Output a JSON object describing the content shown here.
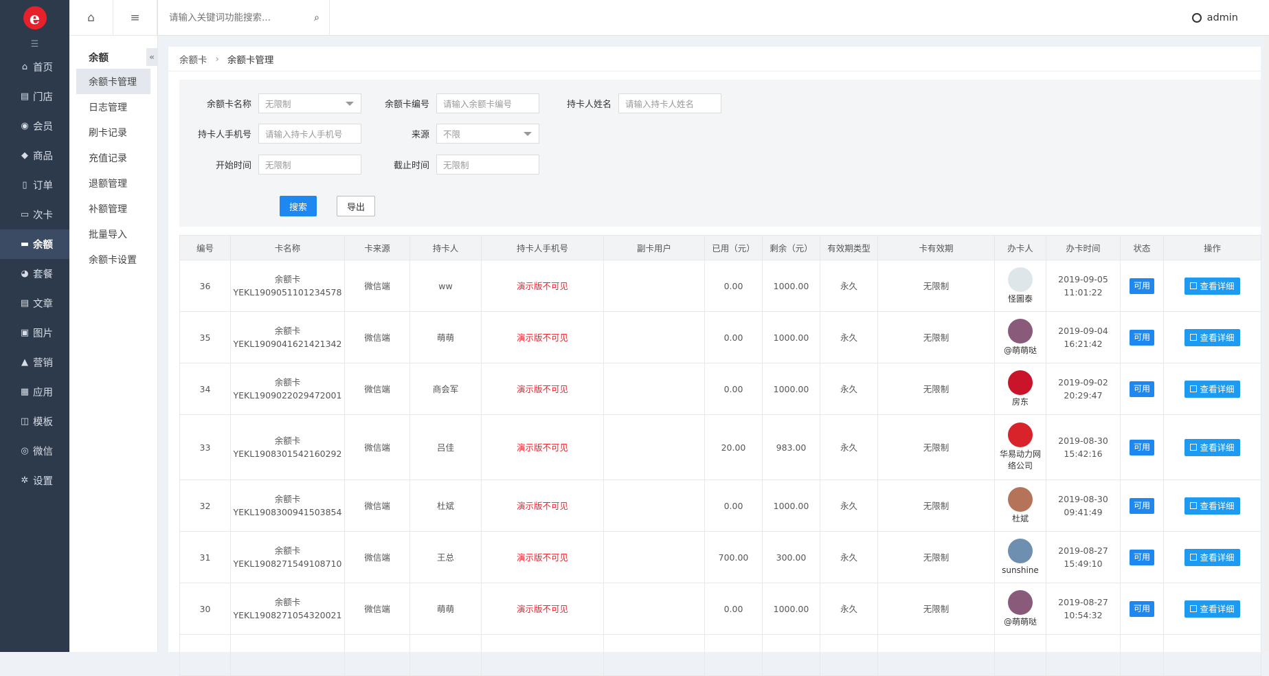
{
  "logo": {
    "letter": "e"
  },
  "nav": {
    "items": [
      {
        "label": "首页",
        "icon": "home-icon",
        "glyph": "⌂"
      },
      {
        "label": "门店",
        "icon": "store-icon",
        "glyph": "▤"
      },
      {
        "label": "会员",
        "icon": "member-icon",
        "glyph": "◉"
      },
      {
        "label": "商品",
        "icon": "tag-icon",
        "glyph": "◆"
      },
      {
        "label": "订单",
        "icon": "order-icon",
        "glyph": "▯"
      },
      {
        "label": "次卡",
        "icon": "card-icon",
        "glyph": "▭"
      },
      {
        "label": "余额",
        "icon": "balance-icon",
        "glyph": "▬",
        "active": true
      },
      {
        "label": "套餐",
        "icon": "dashboard-icon",
        "glyph": "◕"
      },
      {
        "label": "文章",
        "icon": "article-icon",
        "glyph": "▤"
      },
      {
        "label": "图片",
        "icon": "image-icon",
        "glyph": "▣"
      },
      {
        "label": "营销",
        "icon": "thumb-icon",
        "glyph": "▲"
      },
      {
        "label": "应用",
        "icon": "apps-icon",
        "glyph": "▦"
      },
      {
        "label": "模板",
        "icon": "template-icon",
        "glyph": "◫"
      },
      {
        "label": "微信",
        "icon": "wechat-icon",
        "glyph": "◎"
      },
      {
        "label": "设置",
        "icon": "settings-icon",
        "glyph": "✲"
      }
    ]
  },
  "submenu": {
    "title": "余额",
    "items": [
      "余额卡管理",
      "日志管理",
      "刷卡记录",
      "充值记录",
      "退额管理",
      "补额管理",
      "批量导入",
      "余额卡设置"
    ]
  },
  "topbar": {
    "search_placeholder": "请输入关键词功能搜索...",
    "user": "admin"
  },
  "breadcrumb": {
    "parent": "余额卡",
    "current": "余额卡管理"
  },
  "filters": {
    "card_name_label": "余额卡名称",
    "card_name_value": "无限制",
    "card_no_label": "余额卡编号",
    "card_no_placeholder": "请输入余额卡编号",
    "holder_label": "持卡人姓名",
    "holder_placeholder": "请输入持卡人姓名",
    "phone_label": "持卡人手机号",
    "phone_placeholder": "请输入持卡人手机号",
    "source_label": "来源",
    "source_value": "不限",
    "start_label": "开始时间",
    "start_value": "无限制",
    "end_label": "截止时间",
    "end_value": "无限制",
    "search_btn": "搜索",
    "export_btn": "导出"
  },
  "table": {
    "headers": [
      "编号",
      "卡名称",
      "卡来源",
      "持卡人",
      "持卡人手机号",
      "副卡用户",
      "已用（元）",
      "剩余（元）",
      "有效期类型",
      "卡有效期",
      "办卡人",
      "办卡时间",
      "状态",
      "操作"
    ],
    "rows": [
      {
        "id": "36",
        "name": "余额卡",
        "code": "YEKL1909051101234578",
        "source": "微信端",
        "holder": "ww",
        "phone": "演示版不可见",
        "sub": "",
        "used": "0.00",
        "left": "1000.00",
        "vtype": "永久",
        "valid": "无限制",
        "issuer": "怪圖泰",
        "avatar_color": "#dfe6ea",
        "date": "2019-09-05",
        "time": "11:01:22",
        "status": "可用",
        "action": "查看详细"
      },
      {
        "id": "35",
        "name": "余额卡",
        "code": "YEKL1909041621421342",
        "source": "微信端",
        "holder": "萌萌",
        "phone": "演示版不可见",
        "sub": "",
        "used": "0.00",
        "left": "1000.00",
        "vtype": "永久",
        "valid": "无限制",
        "issuer": "@萌萌哒",
        "avatar_color": "#8a5a7a",
        "date": "2019-09-04",
        "time": "16:21:42",
        "status": "可用",
        "action": "查看详细"
      },
      {
        "id": "34",
        "name": "余额卡",
        "code": "YEKL1909022029472001",
        "source": "微信端",
        "holder": "商会军",
        "phone": "演示版不可见",
        "sub": "",
        "used": "0.00",
        "left": "1000.00",
        "vtype": "永久",
        "valid": "无限制",
        "issuer": "房东",
        "avatar_color": "#c9142a",
        "date": "2019-09-02",
        "time": "20:29:47",
        "status": "可用",
        "action": "查看详细"
      },
      {
        "id": "33",
        "name": "余额卡",
        "code": "YEKL1908301542160292",
        "source": "微信端",
        "holder": "吕佳",
        "phone": "演示版不可见",
        "sub": "",
        "used": "20.00",
        "left": "983.00",
        "vtype": "永久",
        "valid": "无限制",
        "issuer": "华易动力网络公司",
        "avatar_color": "#d8232a",
        "date": "2019-08-30",
        "time": "15:42:16",
        "status": "可用",
        "action": "查看详细"
      },
      {
        "id": "32",
        "name": "余额卡",
        "code": "YEKL1908300941503854",
        "source": "微信端",
        "holder": "杜斌",
        "phone": "演示版不可见",
        "sub": "",
        "used": "0.00",
        "left": "1000.00",
        "vtype": "永久",
        "valid": "无限制",
        "issuer": "杜斌",
        "avatar_color": "#b5745a",
        "date": "2019-08-30",
        "time": "09:41:49",
        "status": "可用",
        "action": "查看详细"
      },
      {
        "id": "31",
        "name": "余额卡",
        "code": "YEKL1908271549108710",
        "source": "微信端",
        "holder": "王总",
        "phone": "演示版不可见",
        "sub": "",
        "used": "700.00",
        "left": "300.00",
        "vtype": "永久",
        "valid": "无限制",
        "issuer": "sunshine",
        "avatar_color": "#6f8fb0",
        "date": "2019-08-27",
        "time": "15:49:10",
        "status": "可用",
        "action": "查看详细"
      },
      {
        "id": "30",
        "name": "余额卡",
        "code": "YEKL1908271054320021",
        "source": "微信端",
        "holder": "萌萌",
        "phone": "演示版不可见",
        "sub": "",
        "used": "0.00",
        "left": "1000.00",
        "vtype": "永久",
        "valid": "无限制",
        "issuer": "@萌萌哒",
        "avatar_color": "#8a5a7a",
        "date": "2019-08-27",
        "time": "10:54:32",
        "status": "可用",
        "action": "查看详细"
      }
    ]
  }
}
